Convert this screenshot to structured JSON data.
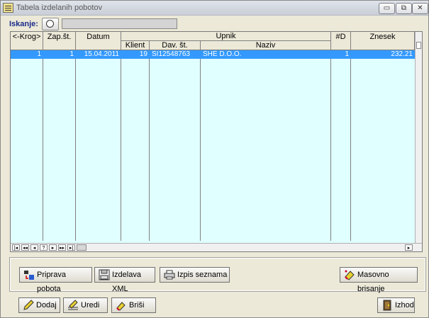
{
  "window": {
    "title": "Tabela izdelanih pobotov",
    "controls": {
      "minimize": "▭",
      "restore": "⧉",
      "close": "✕"
    }
  },
  "search": {
    "label": "Iskanje:",
    "button_text": "⚙",
    "value": ""
  },
  "table": {
    "headers": {
      "krog": "<-Krog>",
      "zap": "Zap.št.",
      "datum": "Datum",
      "upnik": "Upnik",
      "klient": "Klient",
      "davst": "Dav. št.",
      "naziv": "Naziv",
      "nd": "#D",
      "znesek": "Znesek"
    },
    "rows": [
      {
        "krog": "1",
        "zap": "1",
        "datum": "15.04.2011",
        "klient": "19",
        "davst": "SI12548763",
        "naziv": "SHE D.O.O.",
        "nd": "1",
        "znesek": "232.21"
      }
    ],
    "nav": [
      "|◂",
      "◂◂",
      "◂",
      "?",
      "▸",
      "▸▸",
      "▸|"
    ]
  },
  "actions": {
    "priprava": "Priprava pobota",
    "xml": "Izdelava XML",
    "izpis": "Izpis seznama",
    "masovno": "Masovno brisanje"
  },
  "footer": {
    "dodaj": "Dodaj",
    "uredi": "Uredi",
    "brisi": "Briši",
    "izhod": "Izhod"
  },
  "colors": {
    "selection": "#3399ff",
    "grid_bg": "#e0ffff",
    "window_bg": "#ece9d8"
  },
  "icons": [
    "search-icon",
    "transfer-icon",
    "floppy-disk-icon",
    "printer-icon",
    "eraser-icon",
    "pencil-icon",
    "edit-lines-icon",
    "delete-icon",
    "exit-door-icon"
  ]
}
